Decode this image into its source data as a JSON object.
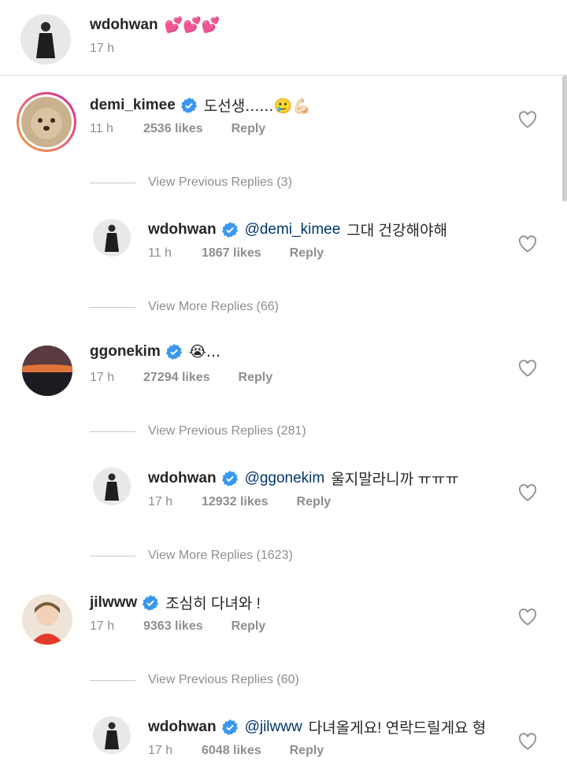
{
  "caption": {
    "username": "wdohwan",
    "text": "💕💕💕",
    "time": "17 h"
  },
  "comments": [
    {
      "username": "demi_kimee",
      "verified": true,
      "text": "도선생......🥲💪🏻",
      "time": "11 h",
      "likes": "2536 likes",
      "reply_label": "Reply",
      "toggle": "View Previous Replies (3)",
      "reply": {
        "username": "wdohwan",
        "mention": "@demi_kimee",
        "text": "그대 건강해야해",
        "time": "11 h",
        "likes": "1867 likes",
        "reply_label": "Reply"
      },
      "more_toggle": "View More Replies (66)"
    },
    {
      "username": "ggonekim",
      "verified": true,
      "text": "😭...",
      "time": "17 h",
      "likes": "27294 likes",
      "reply_label": "Reply",
      "toggle": "View Previous Replies (281)",
      "reply": {
        "username": "wdohwan",
        "mention": "@ggonekim",
        "text": "울지말라니까 ㅠㅠㅠ",
        "time": "17 h",
        "likes": "12932 likes",
        "reply_label": "Reply"
      },
      "more_toggle": "View More Replies (1623)"
    },
    {
      "username": "jilwww",
      "verified": true,
      "text": "조심히 다녀와 !",
      "time": "17 h",
      "likes": "9363 likes",
      "reply_label": "Reply",
      "toggle": "View Previous Replies (60)",
      "reply": {
        "username": "wdohwan",
        "mention": "@jilwww",
        "text": "다녀올게요! 연락드릴게요 형",
        "time": "17 h",
        "likes": "6048 likes",
        "reply_label": "Reply"
      }
    }
  ],
  "colors": {
    "text": "#262626",
    "muted": "#8e8e8e",
    "mention": "#00376b",
    "verified": "#3897f0",
    "story_ring_start": "#f9a03f",
    "story_ring_end": "#d6249f"
  }
}
